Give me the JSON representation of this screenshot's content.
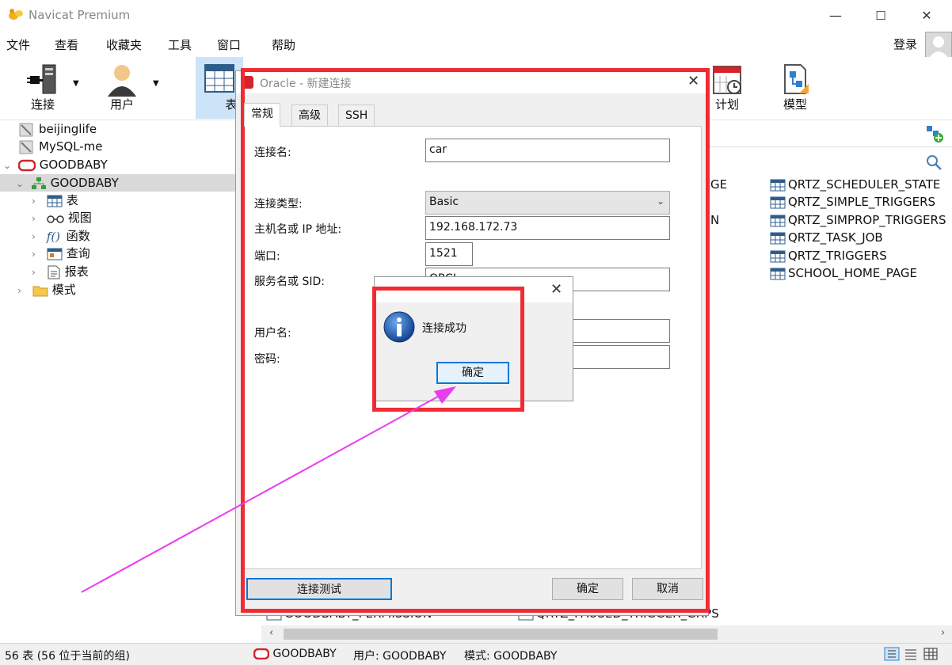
{
  "window": {
    "title": "Navicat Premium"
  },
  "menu": [
    "文件",
    "查看",
    "收藏夹",
    "工具",
    "窗口",
    "帮助"
  ],
  "login_label": "登录",
  "toolbar": {
    "connect": "连接",
    "user": "用户",
    "table": "表",
    "schedule": "计划",
    "model": "模型"
  },
  "tree": {
    "connections": [
      "beijinglife",
      "MySQL-me",
      "GOODBABY"
    ],
    "database": "GOODBABY",
    "children": [
      "表",
      "视图",
      "函数",
      "查询",
      "报表"
    ],
    "schema": "模式"
  },
  "objects": {
    "partial": [
      "GE",
      "N"
    ],
    "right_column": [
      "QRTZ_SCHEDULER_STATE",
      "QRTZ_SIMPLE_TRIGGERS",
      "QRTZ_SIMPROP_TRIGGERS",
      "QRTZ_TASK_JOB",
      "QRTZ_TRIGGERS",
      "SCHOOL_HOME_PAGE"
    ],
    "bottom_left": "GOODBABY_PERMISSION",
    "bottom_right": "QRTZ_PAUSED_TRIGGER_GRPS"
  },
  "status": {
    "count": "56 表 (56 位于当前的组)",
    "connection": "GOODBABY",
    "user": "用户: GOODBABY",
    "schema": "模式: GOODBABY"
  },
  "dialog": {
    "title": "Oracle - 新建连接",
    "tabs": [
      "常规",
      "高级",
      "SSH"
    ],
    "fields": {
      "conn_name_label": "连接名:",
      "conn_name_value": "car",
      "conn_type_label": "连接类型:",
      "conn_type_value": "Basic",
      "host_label": "主机名或 IP 地址:",
      "host_value": "192.168.172.73",
      "port_label": "端口:",
      "port_value": "1521",
      "sid_label": "服务名或 SID:",
      "sid_value": "ORCL",
      "username_label": "用户名:",
      "password_label": "密码:"
    },
    "buttons": {
      "test": "连接测试",
      "ok": "确定",
      "cancel": "取消"
    }
  },
  "msgbox": {
    "message": "连接成功",
    "ok": "确定"
  },
  "colors": {
    "annotation_red": "#f02b33",
    "annotation_arrow": "#e93cf0",
    "focus_blue": "#0078d7",
    "selection_bg": "#cde3f7"
  }
}
